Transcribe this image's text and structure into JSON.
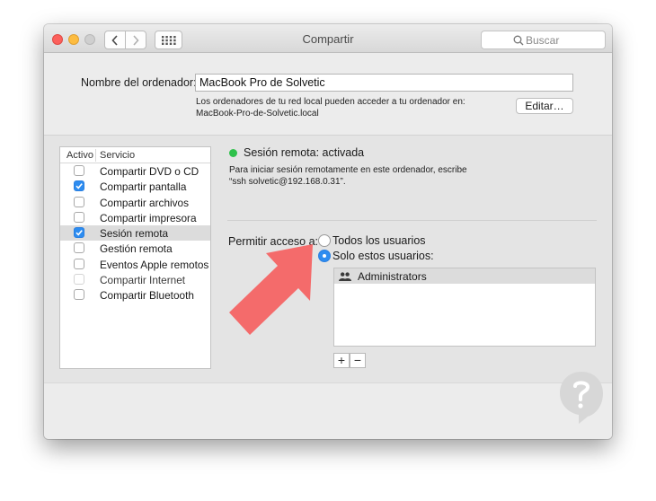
{
  "window": {
    "title": "Compartir",
    "nav_back_icon": "chevron-left-icon",
    "nav_forward_icon": "chevron-right-icon",
    "grid_icon": "grid-icon",
    "search_placeholder": "Buscar"
  },
  "computer_name": {
    "label": "Nombre del ordenador:",
    "value": "MacBook Pro de Solvetic",
    "hint_line1": "Los ordenadores de tu red local pueden acceder a tu ordenador en:",
    "hint_line2": "MacBook-Pro-de-Solvetic.local",
    "edit_label": "Editar…"
  },
  "services": {
    "col_active": "Activo",
    "col_service": "Servicio",
    "items": [
      {
        "label": "Compartir DVD o CD",
        "checked": false
      },
      {
        "label": "Compartir pantalla",
        "checked": true
      },
      {
        "label": "Compartir archivos",
        "checked": false
      },
      {
        "label": "Compartir impresora",
        "checked": false
      },
      {
        "label": "Sesión remota",
        "checked": true,
        "selected": true
      },
      {
        "label": "Gestión remota",
        "checked": false
      },
      {
        "label": "Eventos Apple remotos",
        "checked": false
      },
      {
        "label": "Compartir Internet",
        "checked": false,
        "disabled": true
      },
      {
        "label": "Compartir Bluetooth",
        "checked": false
      }
    ]
  },
  "detail": {
    "status": "Sesión remota: activada",
    "status_color": "#2fc14b",
    "hint_line1": "Para iniciar sesión remotamente en este ordenador, escribe",
    "hint_line2": "“ssh solvetic@192.168.0.31”.",
    "access_label": "Permitir acceso a:",
    "option_all": "Todos los usuarios",
    "option_only": "Solo estos usuarios:",
    "selected_option": "only",
    "users": [
      {
        "name": "Administrators",
        "icon": "group-icon"
      }
    ],
    "add_label": "+",
    "remove_label": "−"
  },
  "colors": {
    "accent": "#2d8cf0",
    "arrow": "#f46b6b"
  }
}
